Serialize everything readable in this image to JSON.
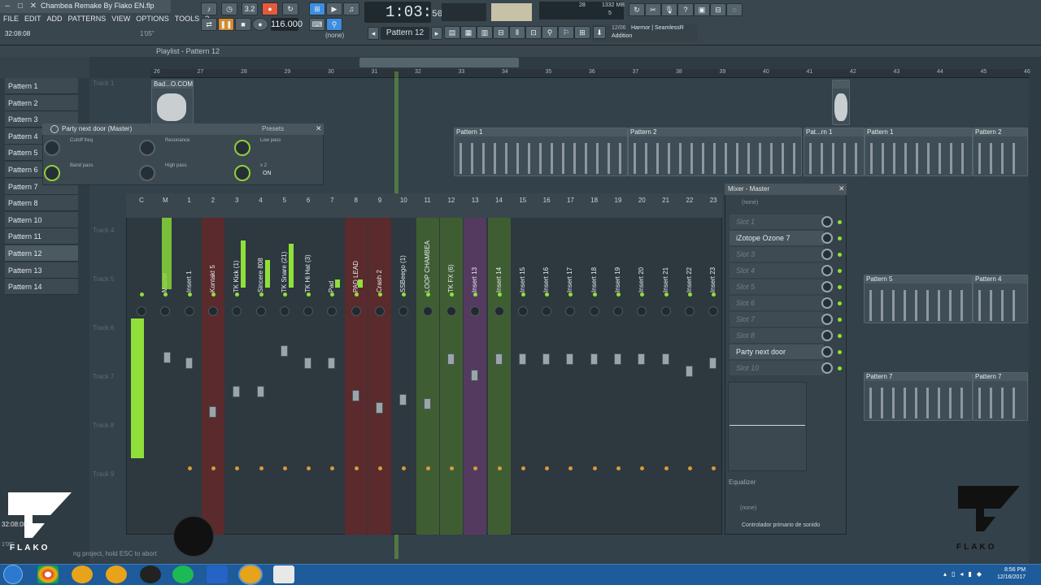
{
  "window": {
    "title": "Chambea Remake By Flako EN.flp"
  },
  "menu": [
    "FILE",
    "EDIT",
    "ADD",
    "PATTERNS",
    "VIEW",
    "OPTIONS",
    "TOOLS",
    "?"
  ],
  "hint": {
    "left": "32:08:08",
    "right": "1'05\""
  },
  "transport": {
    "bpm": "116.000",
    "time_main": "1:03",
    "time_sub": "50",
    "rec_label": "3.2"
  },
  "pattern_selector": {
    "label": "Pattern 12",
    "none_label": "(none)"
  },
  "system": {
    "cpu": "28",
    "ram": "1332 MB",
    "voices": "5"
  },
  "news": {
    "date": "12/06",
    "title": "Harmor | SeamlessR",
    "sub": "Addition"
  },
  "playlist": {
    "title": "Playlist - Pattern 12",
    "ruler": [
      "26",
      "27",
      "28",
      "29",
      "30",
      "31",
      "32",
      "33",
      "34",
      "35",
      "36",
      "37",
      "38",
      "39",
      "40",
      "41",
      "42",
      "43",
      "44",
      "45",
      "46"
    ],
    "tracks": [
      "Track 1",
      "Track 4",
      "Track 5",
      "Track 6",
      "Track 7",
      "Track 8",
      "Track 9"
    ]
  },
  "patterns": [
    "Pattern 1",
    "Pattern 2",
    "Pattern 3",
    "Pattern 4",
    "Pattern 5",
    "Pattern 6",
    "Pattern 7",
    "Pattern 8",
    "Pattern 10",
    "Pattern 11",
    "Pattern 12",
    "Pattern 13",
    "Pattern 14"
  ],
  "clips": {
    "audio": "Bad...O.COM)",
    "row2": [
      "Pattern 1",
      "Pattern 2",
      "Pat...rn 1",
      "Pattern 1",
      "Pattern 2"
    ],
    "row5": [
      "Pattern 5",
      "Pattern 4"
    ],
    "row7": [
      "Pattern 7",
      "Pattern 7"
    ]
  },
  "plugin": {
    "title": "Party next door (Master)",
    "presets": "Presets",
    "labels": [
      "Cutoff freq",
      "Resonance",
      "Low pass",
      "Band pass",
      "High pass",
      "x 2"
    ],
    "on": "ON"
  },
  "mixer": {
    "numbers": [
      "C",
      "M",
      "1",
      "2",
      "3",
      "4",
      "5",
      "6",
      "7",
      "8",
      "9",
      "10",
      "11",
      "12",
      "13",
      "14",
      "15",
      "16",
      "17",
      "18",
      "19",
      "20",
      "21",
      "22",
      "23"
    ],
    "names": [
      "",
      "Master",
      "Insert 1",
      "Kontakt 5",
      "TK Kick (1)",
      "Sincere 808",
      "TK Snare (21)",
      "TK Hi Hat (3)",
      "Pad",
      "PAD LEAD",
      "Crash 2",
      "SSBeego (1)",
      "LOOP CHAMBEA",
      "TK FX (6)",
      "Insert 13",
      "Insert 14",
      "Insert 15",
      "Insert 16",
      "Insert 17",
      "Insert 18",
      "Insert 19",
      "Insert 20",
      "Insert 21",
      "Insert 22",
      "Insert 23"
    ]
  },
  "mixer_panel": {
    "title": "Mixer - Master",
    "none_top": "(none)",
    "slots": [
      "Slot 1",
      "iZotope Ozone 7",
      "Slot 3",
      "Slot 4",
      "Slot 5",
      "Slot 6",
      "Slot 7",
      "Slot 8",
      "Party next door",
      "Slot 10"
    ],
    "eq_label": "Equalizer",
    "none_bottom": "(none)",
    "output": "Controlador primario de sonido"
  },
  "status": {
    "text": "ng project, hold ESC to abort",
    "time": "32:08:08",
    "len": "1'05\""
  },
  "logo": {
    "text": "FLAKO",
    "sub": "EL NATURAL"
  },
  "taskbar": {
    "time": "8:56 PM",
    "date": "12/16/2017"
  },
  "colors": {
    "accent": "#8fe03a",
    "red_strip": "#5a2a2d",
    "green_strip": "#3f5d33",
    "purple_strip": "#553a60",
    "taskbar": "#1d5b9a"
  }
}
